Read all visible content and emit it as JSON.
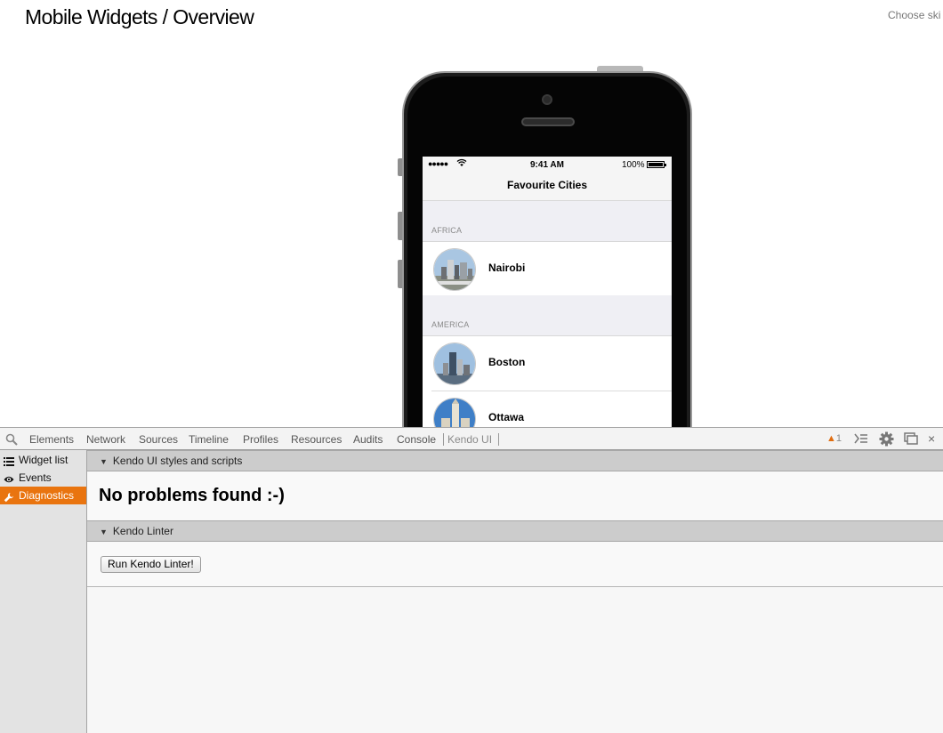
{
  "page": {
    "title": "Mobile Widgets / Overview",
    "skin_chooser_label": "Choose ski"
  },
  "phone": {
    "status_bar": {
      "signal": "●●●●●",
      "time": "9:41 AM",
      "battery": "100%",
      "battery_level": 1.0
    },
    "navbar_title": "Favourite Cities",
    "groups": [
      {
        "label": "AFRICA",
        "items": [
          {
            "name": "Nairobi"
          }
        ]
      },
      {
        "label": "AMERICA",
        "items": [
          {
            "name": "Boston"
          },
          {
            "name": "Ottawa"
          }
        ]
      }
    ]
  },
  "devtools": {
    "tabs": [
      "Elements",
      "Network",
      "Sources",
      "Timeline",
      "Profiles",
      "Resources",
      "Audits",
      "Console",
      "Kendo UI"
    ],
    "active_tab": "Kendo UI",
    "warning_count": "1",
    "sidebar": {
      "items": [
        {
          "label": "Widget list",
          "icon": "list-icon"
        },
        {
          "label": "Events",
          "icon": "eye-icon"
        },
        {
          "label": "Diagnostics",
          "icon": "wrench-icon"
        }
      ],
      "selected": "Diagnostics"
    },
    "sections": [
      {
        "title": "Kendo UI styles and scripts",
        "message": "No problems found :-)"
      },
      {
        "title": "Kendo Linter",
        "button_label": "Run Kendo Linter!"
      }
    ]
  },
  "colors": {
    "accent": "#e9740f",
    "section_header": "#cccccc",
    "sidebar_bg": "#e3e3e3",
    "warning": "#e06d10"
  }
}
